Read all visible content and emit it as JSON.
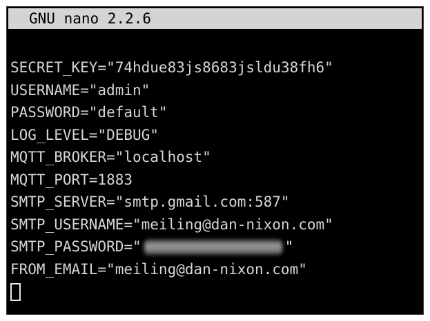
{
  "editor": {
    "title": "GNU nano 2.2.6"
  },
  "file": {
    "lines": [
      "SECRET_KEY=\"74hdue83js8683jsldu38fh6\"",
      "USERNAME=\"admin\"",
      "PASSWORD=\"default\"",
      "LOG_LEVEL=\"DEBUG\"",
      "MQTT_BROKER=\"localhost\"",
      "MQTT_PORT=1883",
      "SMTP_SERVER=\"smtp.gmail.com:587\"",
      "SMTP_USERNAME=\"meiling@dan-nixon.com\"",
      "SMTP_PASSWORD=\"",
      "FROM_EMAIL=\"meiling@dan-nixon.com\""
    ],
    "password_suffix": "\""
  },
  "colors": {
    "background": "#000000",
    "text": "#d6d6d6",
    "titlebar_bg": "#d4d4d4",
    "titlebar_text": "#000000"
  }
}
